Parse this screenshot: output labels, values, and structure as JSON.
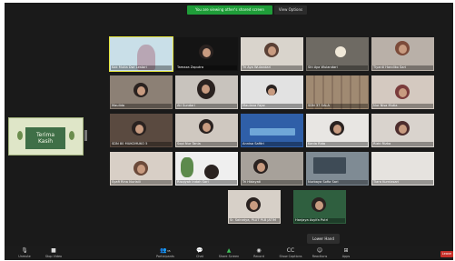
{
  "top": {
    "share_label": "You are viewing other's shared screen",
    "view_options_label": "View Options"
  },
  "sidebar_share": {
    "line1": "Terima",
    "line2": "Kasih"
  },
  "tiles": [
    {
      "label": "Kak Mutia Dwi Lestari",
      "hand": true,
      "active": true
    },
    {
      "label": "Tamaza Zaputra",
      "hand": true
    },
    {
      "label": "Tri Aya Wulandari"
    },
    {
      "label": "Siti Aya Wulandari"
    },
    {
      "label": "Tiyanti Handiko Sari"
    },
    {
      "label": "Maulida"
    },
    {
      "label": "Ati Sundari"
    },
    {
      "label": "Maulana Fajar"
    },
    {
      "label": "SDN 37 SALA"
    },
    {
      "label": "Nur Nisa Mutia"
    },
    {
      "label": "SDN 80 MUKOMUKO 5"
    },
    {
      "label": "Sopi Nur Tania"
    },
    {
      "label": "Annisa Safitri"
    },
    {
      "label": "Kania Rida"
    },
    {
      "label": "Rizki Rizka"
    },
    {
      "label": "Syafi Rina Nurlaili"
    },
    {
      "label": "Risqiyah Indah Sari"
    },
    {
      "label": "Tri Hidayati"
    },
    {
      "label": "Nurbaya Sofia Sari"
    },
    {
      "label": "Tiara Kurniasari"
    },
    {
      "label": "Sr. Sainatya, PLUT PLB JATIM"
    },
    {
      "label": "Hanjaya Asyifa Putri"
    }
  ],
  "leave_hand_label": "Lower Hand",
  "toolbar": {
    "unmute": "Unmute",
    "stop_video": "Stop Video",
    "participants": "Participants",
    "participants_count": "35",
    "chat": "Chat",
    "share_screen": "Share Screen",
    "record": "Record",
    "show_captions": "Show Captions",
    "reactions": "Reactions",
    "apps": "Apps",
    "end": "Leave"
  },
  "colors": {
    "share_bar": "#1f9d39",
    "end_button": "#c7302a",
    "active_speaker": "#e6e640"
  }
}
